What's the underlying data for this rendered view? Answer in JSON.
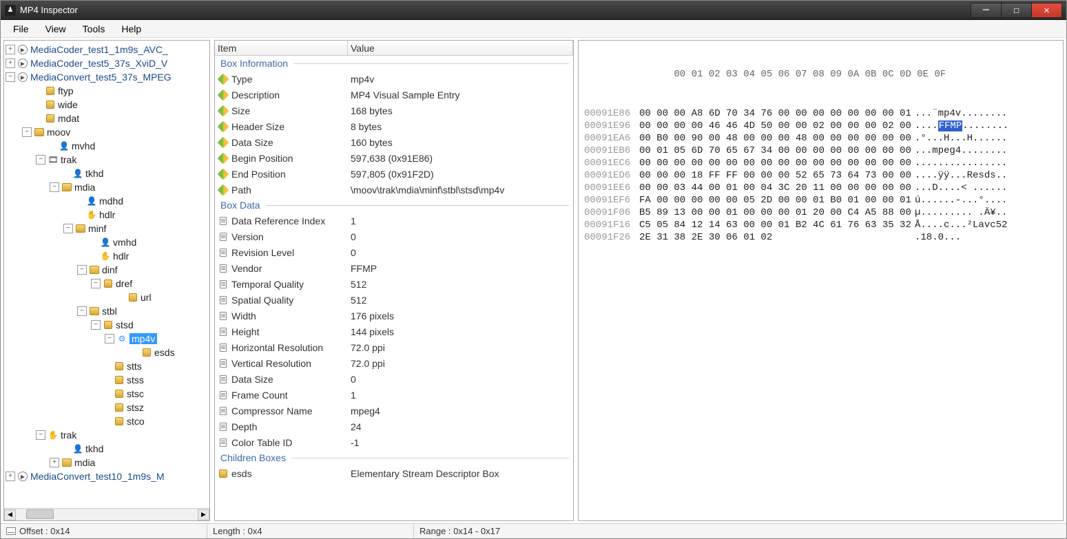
{
  "window": {
    "title": "MP4 Inspector"
  },
  "menu": {
    "file": "File",
    "view": "View",
    "tools": "Tools",
    "help": "Help"
  },
  "tree": {
    "f1": "MediaCoder_test1_1m9s_AVC_",
    "f2": "MediaCoder_test5_37s_XviD_V",
    "f3": "MediaConvert_test5_37s_MPEG",
    "ftyp": "ftyp",
    "wide": "wide",
    "mdat": "mdat",
    "moov": "moov",
    "mvhd": "mvhd",
    "trak": "trak",
    "tkhd": "tkhd",
    "mdia": "mdia",
    "mdhd": "mdhd",
    "hdlr": "hdlr",
    "minf": "minf",
    "vmhd": "vmhd",
    "dinf": "dinf",
    "dref": "dref",
    "url": "url",
    "stbl": "stbl",
    "stsd": "stsd",
    "mp4v": "mp4v",
    "esds": "esds",
    "stts": "stts",
    "stss": "stss",
    "stsc": "stsc",
    "stsz": "stsz",
    "stco": "stco",
    "f4": "MediaConvert_test10_1m9s_M"
  },
  "details": {
    "header_item": "Item",
    "header_value": "Value",
    "sec_boxinfo": "Box Information",
    "sec_boxdata": "Box Data",
    "sec_children": "Children Boxes",
    "type_k": "Type",
    "type_v": "mp4v",
    "desc_k": "Description",
    "desc_v": "MP4 Visual Sample Entry",
    "size_k": "Size",
    "size_v": "168 bytes",
    "hsize_k": "Header Size",
    "hsize_v": "8 bytes",
    "dsize_k": "Data Size",
    "dsize_v": "160 bytes",
    "bpos_k": "Begin Position",
    "bpos_v": "597,638 (0x91E86)",
    "epos_k": "End Position",
    "epos_v": "597,805 (0x91F2D)",
    "path_k": "Path",
    "path_v": "\\moov\\trak\\mdia\\minf\\stbl\\stsd\\mp4v",
    "dridx_k": "Data Reference Index",
    "dridx_v": "1",
    "ver_k": "Version",
    "ver_v": "0",
    "rev_k": "Revision Level",
    "rev_v": "0",
    "vendor_k": "Vendor",
    "vendor_v": "FFMP",
    "tq_k": "Temporal Quality",
    "tq_v": "512",
    "sq_k": "Spatial Quality",
    "sq_v": "512",
    "w_k": "Width",
    "w_v": "176 pixels",
    "h_k": "Height",
    "h_v": "144 pixels",
    "hr_k": "Horizontal Resolution",
    "hr_v": "72.0 ppi",
    "vr_k": "Vertical Resolution",
    "vr_v": "72.0 ppi",
    "ds2_k": "Data Size",
    "ds2_v": "0",
    "fc_k": "Frame Count",
    "fc_v": "1",
    "cn_k": "Compressor Name",
    "cn_v": "mpeg4",
    "depth_k": "Depth",
    "depth_v": "24",
    "ct_k": "Color Table ID",
    "ct_v": "-1",
    "child_esds_k": "esds",
    "child_esds_v": "Elementary Stream Descriptor Box"
  },
  "hex": {
    "header": "      00 01 02 03 04 05 06 07 08 09 0A 0B 0C 0D 0E 0F",
    "rows": [
      {
        "a": "00091E86",
        "b": "00 00 00 A8 6D 70 34 76 00 00 00 00 00 00 00 01",
        "t": "...¨mp4v........"
      },
      {
        "a": "00091E96",
        "b": "00 00 00 00 46 46 4D 50 00 00 02 00 00 00 02 00",
        "t": "....",
        "hl": "FFMP",
        "t2": "........"
      },
      {
        "a": "00091EA6",
        "b": "00 B0 00 90 00 48 00 00 00 48 00 00 00 00 00 00",
        "t": ".°...H...H......"
      },
      {
        "a": "00091EB6",
        "b": "00 01 05 6D 70 65 67 34 00 00 00 00 00 00 00 00",
        "t": "...mpeg4........"
      },
      {
        "a": "00091EC6",
        "b": "00 00 00 00 00 00 00 00 00 00 00 00 00 00 00 00",
        "t": "................"
      },
      {
        "a": "00091ED6",
        "b": "00 00 00 18 FF FF 00 00 00 52 65 73 64 73 00 00",
        "t": "....ÿÿ...Resds.."
      },
      {
        "a": "00091EE6",
        "b": "00 00 03 44 00 01 00 04 3C 20 11 00 00 00 00 00",
        "t": "...D....< ......"
      },
      {
        "a": "00091EF6",
        "b": "FA 00 00 00 00 00 05 2D 00 00 01 B0 01 00 00 01",
        "t": "ú......-...°...."
      },
      {
        "a": "00091F06",
        "b": "B5 89 13 00 00 01 00 00 00 01 20 00 C4 A5 88 00",
        "t": "µ......... .Ä¥.."
      },
      {
        "a": "00091F16",
        "b": "C5 05 84 12 14 63 00 00 01 B2 4C 61 76 63 35 32",
        "t": "Å....c...²Lavc52"
      },
      {
        "a": "00091F26",
        "b": "2E 31 38 2E 30 06 01 02",
        "t": ".18.0..."
      }
    ]
  },
  "status": {
    "offset": "Offset : 0x14",
    "length": "Length : 0x4",
    "range": "Range : 0x14 - 0x17"
  }
}
